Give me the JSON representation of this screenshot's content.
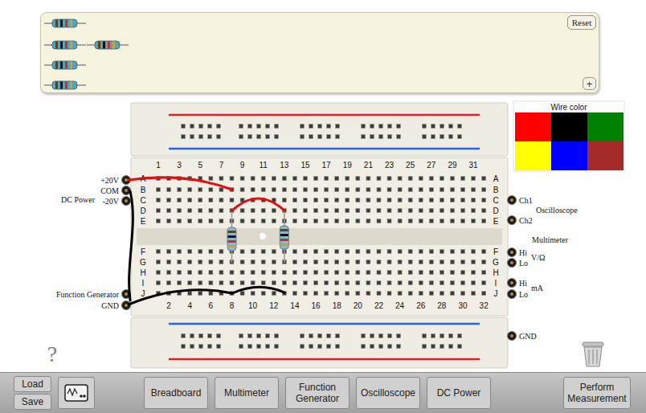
{
  "tray": {
    "reset": "Reset",
    "add": "+"
  },
  "breadboard": {
    "top_numbers": [
      "1",
      "3",
      "5",
      "7",
      "9",
      "11",
      "13",
      "15",
      "17",
      "19",
      "21",
      "23",
      "25",
      "27",
      "29",
      "31"
    ],
    "bottom_numbers": [
      "2",
      "4",
      "6",
      "8",
      "10",
      "12",
      "14",
      "16",
      "18",
      "20",
      "22",
      "24",
      "26",
      "28",
      "30",
      "32"
    ],
    "row_letters_left": [
      "A",
      "B",
      "C",
      "D",
      "E",
      "F",
      "G",
      "H",
      "I",
      "J"
    ],
    "row_letters_right": [
      "A",
      "B",
      "C",
      "D",
      "E",
      "F",
      "G",
      "H",
      "I",
      "J"
    ]
  },
  "dc_power": {
    "title": "DC Power",
    "terminals": [
      "+20V",
      "COM",
      "-20V"
    ]
  },
  "function_generator": {
    "title": "Function Generator",
    "terminals": [
      "GND"
    ]
  },
  "oscilloscope": {
    "title": "Oscilloscope",
    "channels": [
      "Ch1",
      "Ch2"
    ]
  },
  "multimeter": {
    "title": "Multimeter",
    "voltage": {
      "hi": "Hi",
      "unit": "V/Ω",
      "lo": "Lo"
    },
    "current": {
      "hi": "Hi",
      "unit": "mA",
      "lo": "Lo"
    }
  },
  "ground": "GND",
  "wire_palette": {
    "title": "Wire color",
    "colors": [
      {
        "color": "#ff0000",
        "selected": false
      },
      {
        "color": "#000000",
        "selected": false
      },
      {
        "color": "#008000",
        "selected": false
      },
      {
        "color": "#ffff00",
        "selected": false
      },
      {
        "color": "#0000ff",
        "selected": false
      },
      {
        "color": "#a52a2a",
        "selected": false
      }
    ]
  },
  "wires": [
    {
      "color": "#e01010"
    },
    {
      "color": "#e01010"
    },
    {
      "color": "#000000"
    },
    {
      "color": "#000000"
    },
    {
      "color": "#000000"
    }
  ],
  "help": "?",
  "toolbar": {
    "file": [
      "Load",
      "Save"
    ],
    "tools": [
      "Breadboard",
      "Multimeter",
      "Function Generator",
      "Oscilloscope",
      "DC Power"
    ],
    "perform": "Perform Measurement"
  }
}
